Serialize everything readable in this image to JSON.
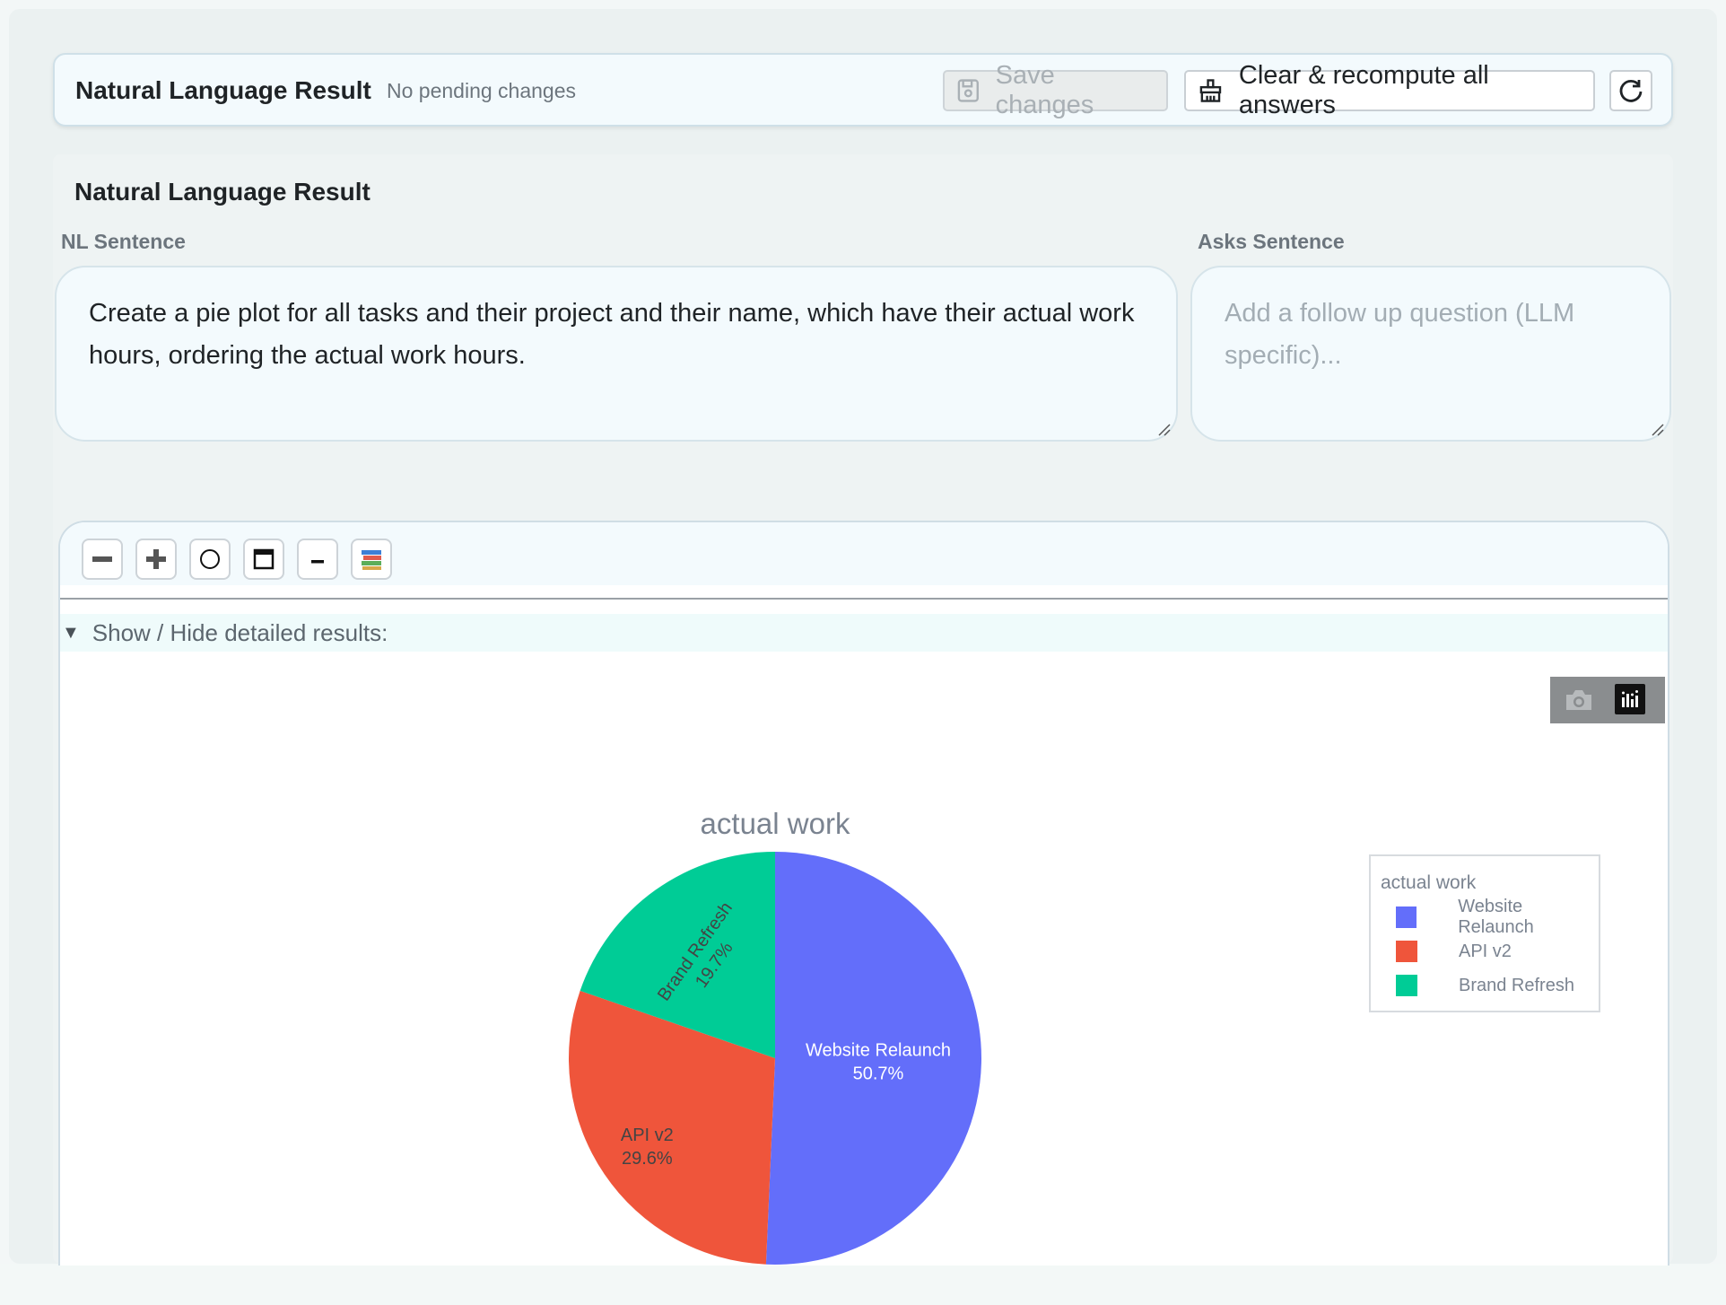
{
  "header": {
    "title": "Natural Language Result",
    "status": "No pending changes",
    "save_label": "Save changes",
    "clear_label": "Clear & recompute all answers"
  },
  "section": {
    "title": "Natural Language Result",
    "nl_label": "NL Sentence",
    "nl_value": "Create a pie plot for all tasks and their project and their name, which have their actual work hours, ordering the actual work hours.",
    "asks_label": "Asks Sentence",
    "asks_placeholder": "Add a follow up question (LLM specific)..."
  },
  "plot": {
    "toggle_label": "Show / Hide detailed results:",
    "tools": [
      "minus-icon",
      "plus-icon",
      "circle-icon",
      "window-icon",
      "dash-icon",
      "books-icon"
    ]
  },
  "chart_data": {
    "type": "pie",
    "title": "actual work",
    "legend_title": "actual work",
    "legend_position": "right",
    "categories": [
      "Website Relaunch",
      "API v2",
      "Brand Refresh"
    ],
    "values": [
      50.7,
      29.6,
      19.7
    ],
    "value_labels": [
      "50.7%",
      "29.6%",
      "19.7%"
    ],
    "colors": [
      "#636efa",
      "#ef553b",
      "#00cc96"
    ]
  }
}
